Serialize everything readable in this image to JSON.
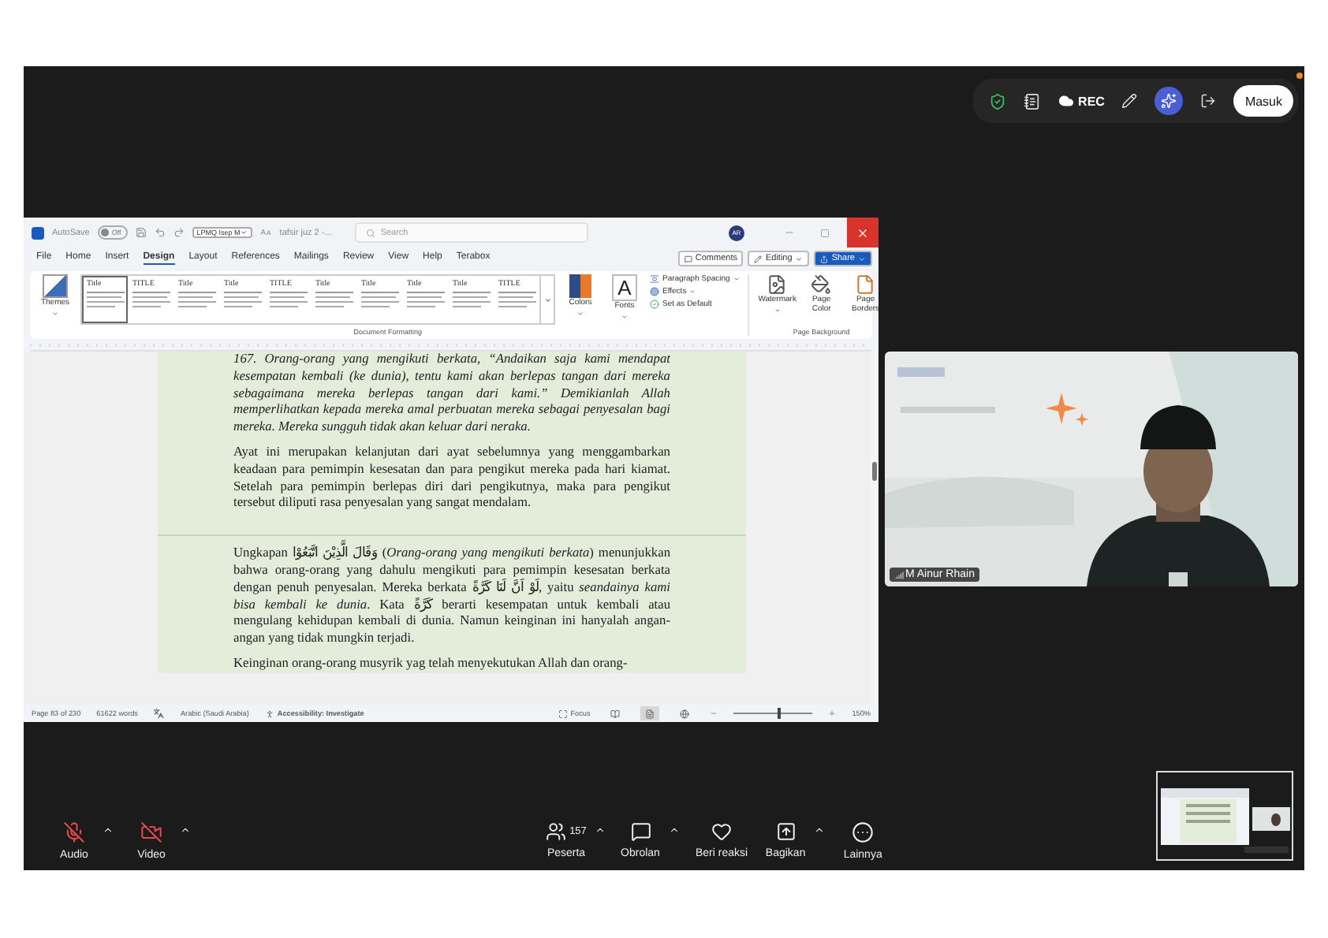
{
  "meeting_top_bar": {
    "rec_label": "REC",
    "sign_in_button": "Masuk",
    "notification": true
  },
  "word_window": {
    "title_bar": {
      "autosave_label": "AutoSave",
      "autosave_state": "Off",
      "autosave_on": false,
      "font_box": "LPMQ Isep M",
      "document_title": "tafsir juz 2 -...",
      "search_placeholder": "Search",
      "account_initials": "AR"
    },
    "menu_tabs": [
      {
        "label": "File",
        "selected": false
      },
      {
        "label": "Home",
        "selected": false
      },
      {
        "label": "Insert",
        "selected": false
      },
      {
        "label": "Design",
        "selected": true
      },
      {
        "label": "Layout",
        "selected": false
      },
      {
        "label": "References",
        "selected": false
      },
      {
        "label": "Mailings",
        "selected": false
      },
      {
        "label": "Review",
        "selected": false
      },
      {
        "label": "View",
        "selected": false
      },
      {
        "label": "Help",
        "selected": false
      },
      {
        "label": "Terabox",
        "selected": false
      }
    ],
    "menu_buttons": {
      "comments": "Comments",
      "editing": "Editing",
      "share": "Share"
    },
    "ribbon": {
      "themes": "Themes",
      "style_gallery": [
        {
          "title": "Title",
          "selected": true
        },
        {
          "title": "TITLE",
          "selected": false
        },
        {
          "title": "Title",
          "selected": false
        },
        {
          "title": "Title",
          "selected": false
        },
        {
          "title": "TITLE",
          "selected": false
        },
        {
          "title": "Title",
          "selected": false
        },
        {
          "title": "Title",
          "selected": false
        },
        {
          "title": "Title",
          "selected": false
        },
        {
          "title": "Title",
          "selected": false
        },
        {
          "title": "TITLE",
          "selected": false
        }
      ],
      "colors": "Colors",
      "fonts": "Fonts",
      "fonts_glyph": "A",
      "paragraph_spacing": "Paragraph Spacing",
      "effects": "Effects",
      "set_as_default": "Set as Default",
      "group_document_formatting": "Document Formatting",
      "watermark": "Watermark",
      "page_color": "Page Color",
      "page_borders": "Page Borders",
      "group_page_background": "Page Background"
    },
    "pages": [
      {
        "paragraphs": [
          {
            "italic": true,
            "text": "167.  Orang-orang yang mengikuti berkata, “Andaikan saja kami mendapat kesempatan kembali (ke dunia), tentu kami akan berlepas tangan dari mereka sebagaimana mereka berlepas tangan dari kami.” Demikianlah Allah memperlihatkan kepada mereka amal perbuatan mereka sebagai penyesalan bagi mereka. Mereka sungguh tidak akan keluar dari neraka."
          },
          {
            "italic": false,
            "text": "Ayat ini merupakan kelanjutan dari ayat sebelumnya yang menggambarkan keadaan para pemimpin kesesatan dan para pengikut mereka pada hari kiamat. Setelah para pemimpin berlepas diri dari pengikutnya, maka para pengikut tersebut diliputi rasa penyesalan yang sangat mendalam."
          }
        ]
      },
      {
        "paragraphs": [
          {
            "italic": false,
            "text": "Ungkapan  وَقَالَ الَّذِيْنَ اتَّبَعُوْا  (*Orang-orang yang mengikuti berkata*) menunjukkan bahwa orang-orang yang dahulu mengikuti para pemimpin kesesatan berkata dengan penuh penyesalan. Mereka berkata لَوْ اَنَّ لَنَا كَرَّةً, yaitu *seandainya kami bisa kembali ke dunia*. Kata كَرَّةً berarti kesempatan untuk kembali atau mengulang kehidupan kembali di dunia. Namun keinginan ini hanyalah angan-angan yang tidak mungkin terjadi."
          },
          {
            "italic": false,
            "text": "Keinginan orang-orang musyrik yag telah menyekutukan Allah dan orang-"
          }
        ]
      }
    ],
    "status_bar": {
      "page": "Page 83 of 230",
      "words": "61622 words",
      "language": "Arabic (Saudi Arabia)",
      "accessibility": "Accessibility: Investigate",
      "focus": "Focus",
      "views": [
        {
          "selected": false
        },
        {
          "selected": true
        },
        {
          "selected": false
        }
      ],
      "zoom": {
        "level": 0.56,
        "reading": "150%"
      }
    }
  },
  "video_tile": {
    "kind": "picture",
    "name": "M Ainur Rhain"
  },
  "controls": [
    {
      "kind": "audio",
      "label": "Audio",
      "off": true,
      "has_menu": true
    },
    {
      "kind": "video",
      "label": "Video",
      "off": true,
      "has_menu": true
    },
    {
      "kind": "participants",
      "label": "Peserta",
      "count": "157",
      "has_menu": true
    },
    {
      "kind": "chat",
      "label": "Obrolan",
      "has_menu": true
    },
    {
      "kind": "react",
      "label": "Beri reaksi",
      "has_menu": false
    },
    {
      "kind": "share",
      "label": "Bagikan",
      "has_menu": true
    },
    {
      "kind": "more",
      "label": "Lainnya",
      "has_menu": false
    }
  ]
}
